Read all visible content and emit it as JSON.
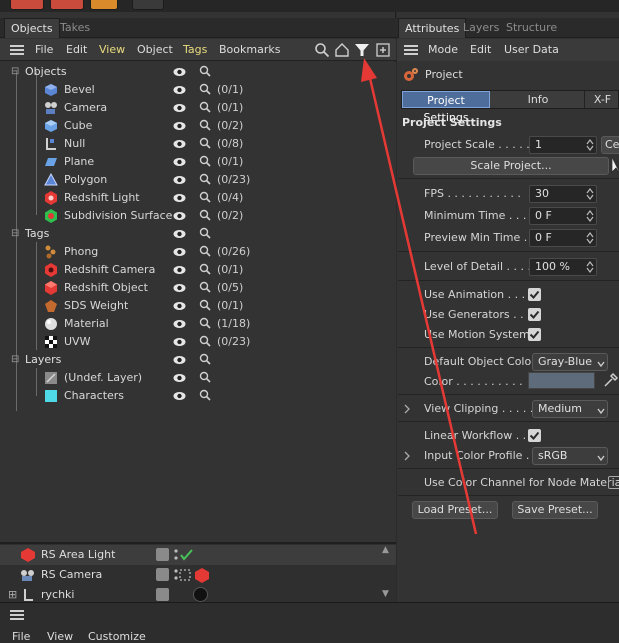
{
  "left_panel": {
    "tabs": [
      {
        "label": "Objects",
        "active": true
      },
      {
        "label": "Takes",
        "active": false
      }
    ],
    "menu": [
      "File",
      "Edit",
      "View",
      "Object",
      "Tags",
      "Bookmarks"
    ],
    "groups": {
      "objects": {
        "label": "Objects",
        "items": [
          {
            "label": "Bevel",
            "count": "(0/1)",
            "icon": "bevel-icon"
          },
          {
            "label": "Camera",
            "count": "(0/1)",
            "icon": "camera-icon"
          },
          {
            "label": "Cube",
            "count": "(0/2)",
            "icon": "cube-icon"
          },
          {
            "label": "Null",
            "count": "(0/8)",
            "icon": "null-icon"
          },
          {
            "label": "Plane",
            "count": "(0/1)",
            "icon": "plane-icon"
          },
          {
            "label": "Polygon",
            "count": "(0/23)",
            "icon": "polygon-icon"
          },
          {
            "label": "Redshift Light",
            "count": "(0/4)",
            "icon": "redshift-light-icon"
          },
          {
            "label": "Subdivision Surface",
            "count": "(0/2)",
            "icon": "subdivision-surface-icon"
          }
        ]
      },
      "tags": {
        "label": "Tags",
        "items": [
          {
            "label": "Phong",
            "count": "(0/26)",
            "icon": "phong-icon"
          },
          {
            "label": "Redshift Camera",
            "count": "(0/1)",
            "icon": "redshift-camera-icon"
          },
          {
            "label": "Redshift Object",
            "count": "(0/5)",
            "icon": "redshift-object-icon"
          },
          {
            "label": "SDS Weight",
            "count": "(0/1)",
            "icon": "sds-weight-icon"
          },
          {
            "label": "Material",
            "count": "(1/18)",
            "icon": "material-icon"
          },
          {
            "label": "UVW",
            "count": "(0/23)",
            "icon": "uvw-icon"
          }
        ]
      },
      "layers": {
        "label": "Layers",
        "items": [
          {
            "label": "(Undef. Layer)",
            "count": "",
            "icon": "undefined-layer-icon"
          },
          {
            "label": "Characters",
            "count": "",
            "icon": "layer-color-icon"
          }
        ]
      }
    },
    "bottom_list": [
      {
        "label": "RS Area Light",
        "icon": "redshift-light-icon"
      },
      {
        "label": "RS Camera",
        "icon": "camera-icon"
      },
      {
        "label": "rychki",
        "icon": "null-icon"
      }
    ]
  },
  "right_panel": {
    "tabs": [
      {
        "label": "Attributes",
        "active": true
      },
      {
        "label": "Layers",
        "active": false
      },
      {
        "label": "Structure",
        "active": false
      }
    ],
    "menu": [
      "Mode",
      "Edit",
      "User Data"
    ],
    "header_title": "Project",
    "subtabs": [
      {
        "label": "Project Settings",
        "active": true
      },
      {
        "label": "Info",
        "active": false
      },
      {
        "label": "X-F",
        "active": false
      }
    ],
    "section_title": "Project Settings",
    "project_scale": {
      "label": "Project Scale . . . . .",
      "value": "1",
      "unit_button": "Ce"
    },
    "scale_button": "Scale Project...",
    "fps": {
      "label": "FPS . . . . . . . . . . .",
      "value": "30"
    },
    "min_time": {
      "label": "Minimum Time . . .",
      "value": "0 F"
    },
    "preview_min_time": {
      "label": "Preview Min Time . .",
      "value": "0 F"
    },
    "level_of_detail": {
      "label": "Level of Detail . . . .",
      "value": "100 %"
    },
    "use_animation": {
      "label": "Use Animation . . . .",
      "checked": true
    },
    "use_generators": {
      "label": "Use Generators . . .",
      "checked": true
    },
    "use_motion_system": {
      "label": "Use Motion System",
      "checked": true
    },
    "default_object_color": {
      "label": "Default Object Color",
      "value": "Gray-Blue"
    },
    "color": {
      "label": "Color . . . . . . . . . .",
      "swatch": "#5e6b7a"
    },
    "view_clipping": {
      "label": "View Clipping . . . . .",
      "value": "Medium"
    },
    "linear_workflow": {
      "label": "Linear Workflow . . .",
      "checked": true
    },
    "input_color_profile": {
      "label": "Input Color Profile . .",
      "value": "sRGB"
    },
    "use_color_channel": {
      "label": "Use Color Channel for Node Material",
      "checked": false
    },
    "load_preset": "Load Preset...",
    "save_preset": "Save Preset..."
  },
  "bottom_panel": {
    "menu": [
      "File",
      "View",
      "Customize"
    ]
  },
  "colors": {
    "accent_tab": "#4f6d9a",
    "annotation_arrow": "#e53935",
    "menu_highlight": "#e9dc7f"
  }
}
